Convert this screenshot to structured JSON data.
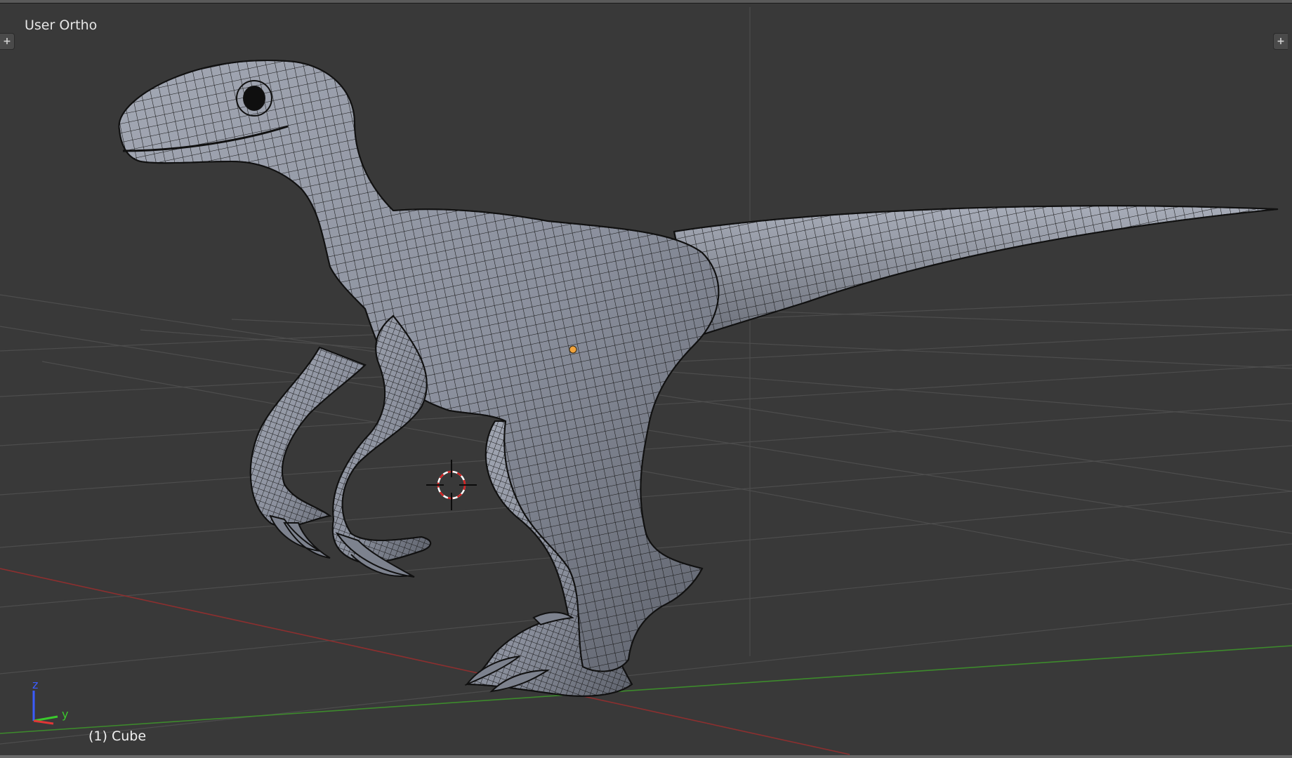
{
  "viewport": {
    "view_label": "User Ortho",
    "object_label": "(1) Cube",
    "axis_labels": {
      "z": "z",
      "y": "y"
    },
    "icons": [
      "add-region-icon",
      "add-region-icon",
      "3d-cursor-icon",
      "axis-gizmo-icon",
      "origin-dot-icon"
    ]
  },
  "colors": {
    "background": "#393939",
    "grid": "#4f4f4f",
    "x_axis": "#8c2f2f",
    "y_axis": "#3d8a2c",
    "mesh_fill": "#8e93a0",
    "wire": "#1a1a1a",
    "origin": "#f1a33c",
    "cursor_red": "#d21f1f",
    "text": "#e6e6e6"
  }
}
